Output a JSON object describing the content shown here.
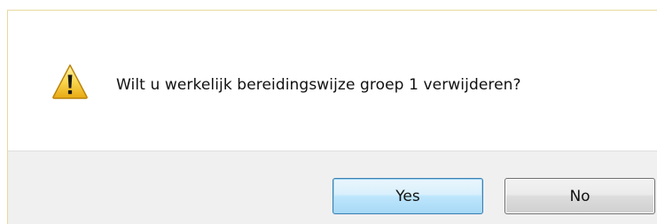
{
  "dialog": {
    "message": "Wilt u werkelijk bereidingswijze groep 1 verwijderen?",
    "icon": "warning-icon",
    "buttons": {
      "yes_label": "Yes",
      "no_label": "No"
    }
  },
  "colors": {
    "footer_background": "#f0f0f0",
    "default_button_border": "#3c7fb1",
    "warning_yellow": "#f7d04a"
  }
}
